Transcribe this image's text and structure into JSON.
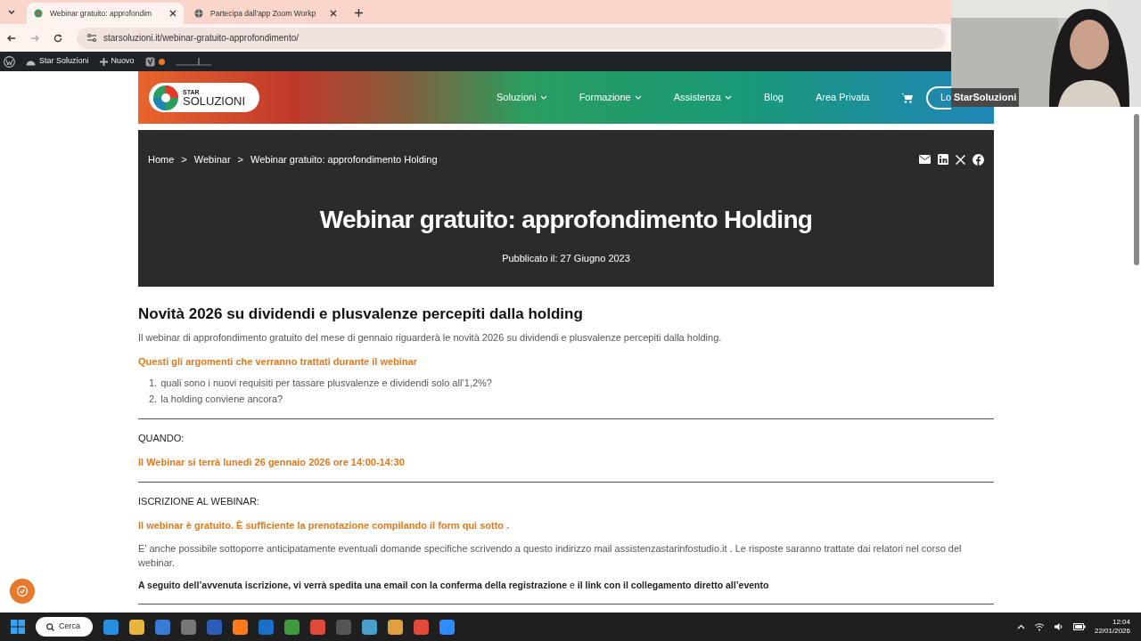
{
  "browser": {
    "tabs": [
      {
        "title": "Webinar gratuito: approfondim",
        "selected": true
      },
      {
        "title": "Partecipa dall'app Zoom Workp",
        "selected": false
      }
    ],
    "url": "starsoluzioni.it/webinar-gratuito-approfondimento/"
  },
  "admin_bar": {
    "site": "Star Soluzioni",
    "new": "Nuovo"
  },
  "site_header": {
    "logo": {
      "line1": "STAR",
      "line2": "SOLUZIONI"
    },
    "nav": [
      {
        "label": "Soluzioni",
        "dropdown": true
      },
      {
        "label": "Formazione",
        "dropdown": true
      },
      {
        "label": "Assistenza",
        "dropdown": true
      },
      {
        "label": "Blog",
        "dropdown": false
      },
      {
        "label": "Area Privata",
        "dropdown": false
      }
    ],
    "login_partial": "Lo"
  },
  "video_overlay": {
    "name": "StarSoluzioni"
  },
  "hero": {
    "breadcrumb": [
      "Home",
      "Webinar",
      "Webinar gratuito: approfondimento Holding"
    ],
    "breadcrumb_separator": ">",
    "title": "Webinar gratuito: approfondimento Holding",
    "published": "Pubblicato il: 27 Giugno 2023"
  },
  "content": {
    "heading": "Novità 2026 su dividendi e plusvalenze percepiti dalla holding",
    "intro": "Il webinar di approfondimento gratuito del mese di gennaio riguarderà le novità 2026 su dividendi e plusvalenze percepiti dalla holding.",
    "topics_heading": "Questi gli argomenti che verranno trattati durante il webinar",
    "topics": [
      {
        "number": "1.",
        "text": "quali sono i nuovi requisiti per tassare plusvalenze e dividendi solo all’1,2%?"
      },
      {
        "number": "2.",
        "text": "la holding conviene ancora?"
      }
    ],
    "when_label": "QUANDO:",
    "when": "Il Webinar si terrà lunedì 26 gennaio 2026 ore 14:00-14:30",
    "signup_label": "ISCRIZIONE AL WEBINAR:",
    "signup": "Il webinar è gratuito. È sufficiente la prenotazione compilando il form qui sotto .",
    "questions": "E’ anche possibile sottoporre anticipatamente eventuali domande specifiche scrivendo a questo indirizzo mail assistenzastarinfostudio.it . Le risposte saranno trattate dai relatori nel corso del webinar.",
    "confirmation": "**A seguito dell’avvenuta iscrizione, vi verrà spedita una email con la conferma della registrazione** e **il link con il collegamento diretto all’evento**"
  },
  "taskbar": {
    "search": "Cerca",
    "time": "12:04",
    "date": "22/01/2026"
  }
}
